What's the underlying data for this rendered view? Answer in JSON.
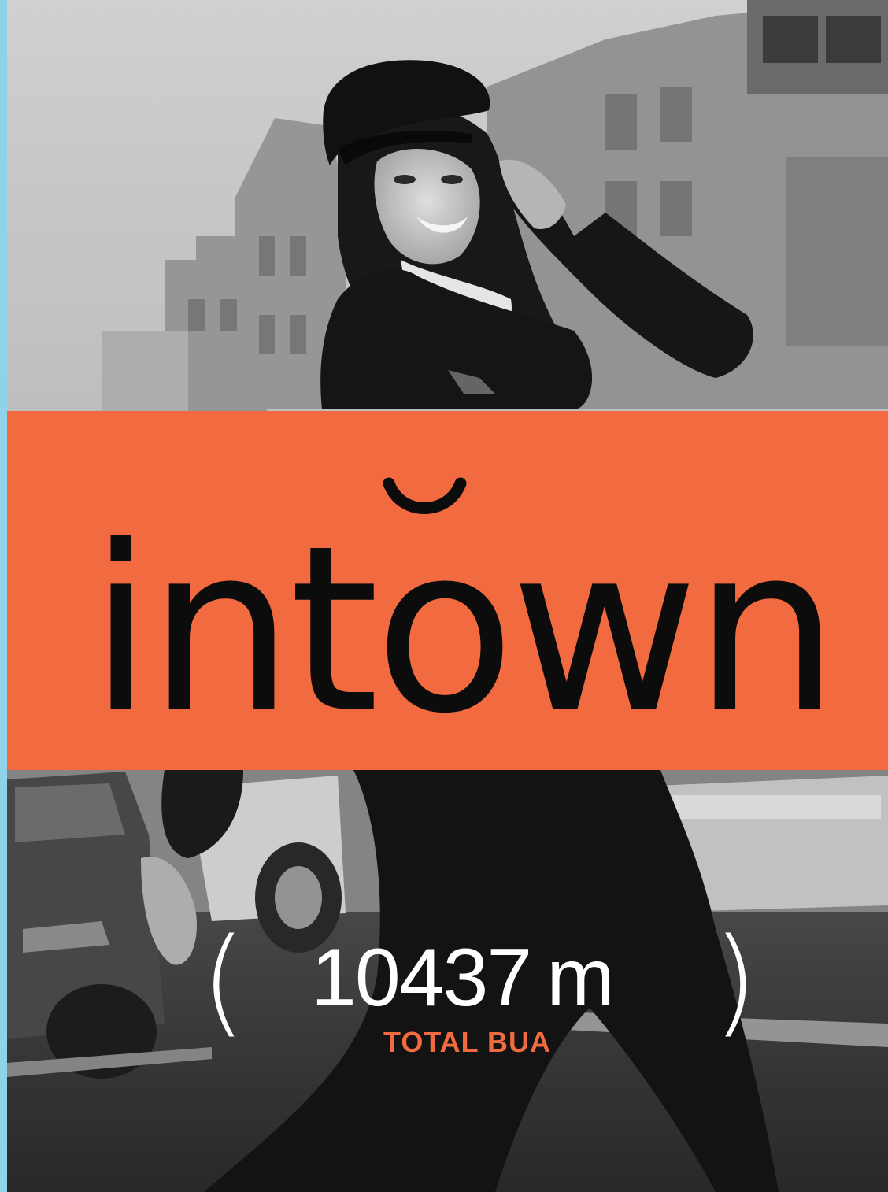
{
  "colors": {
    "accent": "#f26a3f",
    "edge": "#8fd3ea",
    "ink": "#0c0c0c",
    "white": "#ffffff"
  },
  "brand": {
    "name": "intown"
  },
  "stat": {
    "open_paren": "(",
    "value": "10437",
    "unit": "m",
    "close_paren": ")",
    "label": "TOTAL BUA"
  }
}
